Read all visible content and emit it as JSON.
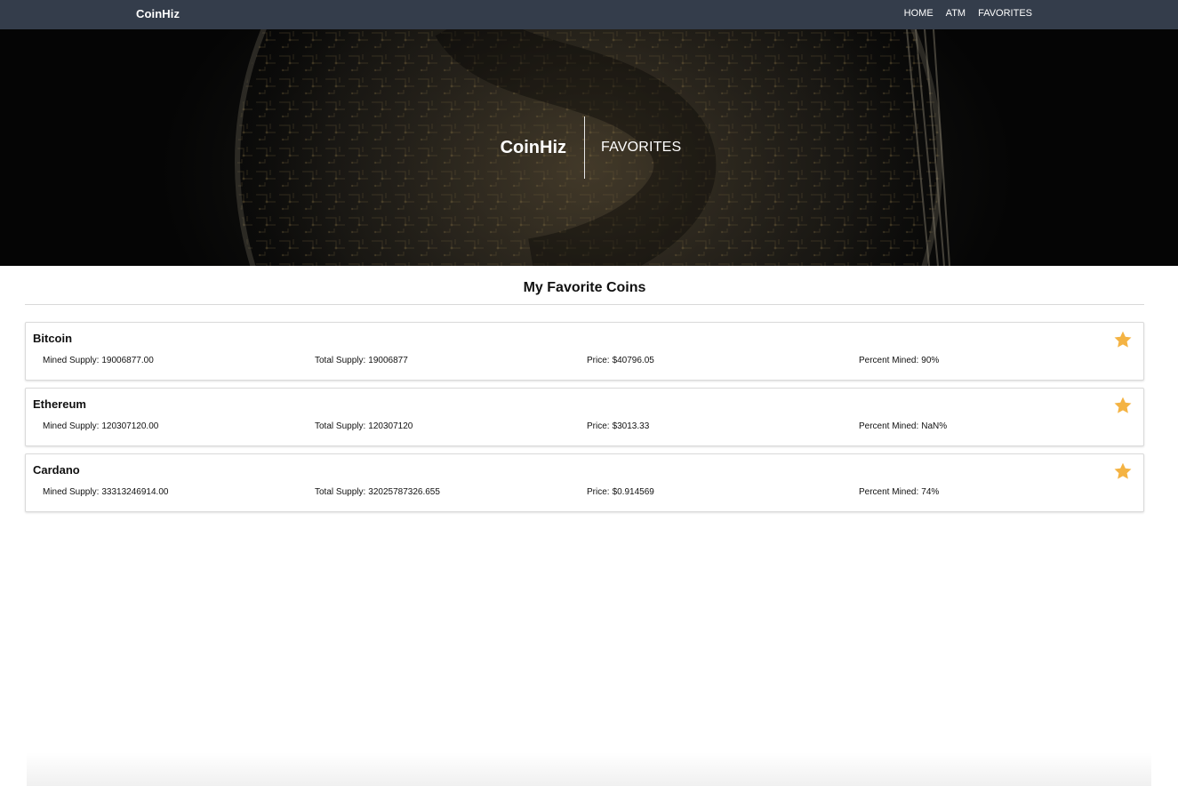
{
  "navbar": {
    "brand": "CoinHiz",
    "links": [
      "HOME",
      "ATM",
      "FAVORITES"
    ]
  },
  "hero": {
    "brand": "CoinHiz",
    "subtitle": "FAVORITES"
  },
  "section": {
    "title": "My Favorite Coins"
  },
  "labels": {
    "mined": "Mined Supply:",
    "total": "Total Supply:",
    "price": "Price:",
    "percent": "Percent Mined:"
  },
  "coins": [
    {
      "name": "Bitcoin",
      "mined_supply": "19006877.00",
      "total_supply": "19006877",
      "price": "$40796.05",
      "percent_mined": "90%",
      "favorite": true
    },
    {
      "name": "Ethereum",
      "mined_supply": "120307120.00",
      "total_supply": "120307120",
      "price": "$3013.33",
      "percent_mined": "NaN%",
      "favorite": true
    },
    {
      "name": "Cardano",
      "mined_supply": "33313246914.00",
      "total_supply": "32025787326.655",
      "price": "$0.914569",
      "percent_mined": "74%",
      "favorite": true
    }
  ],
  "colors": {
    "navbar": "#343d4b",
    "star": "#f4b343"
  },
  "icons": {
    "favorite": "star-icon"
  }
}
